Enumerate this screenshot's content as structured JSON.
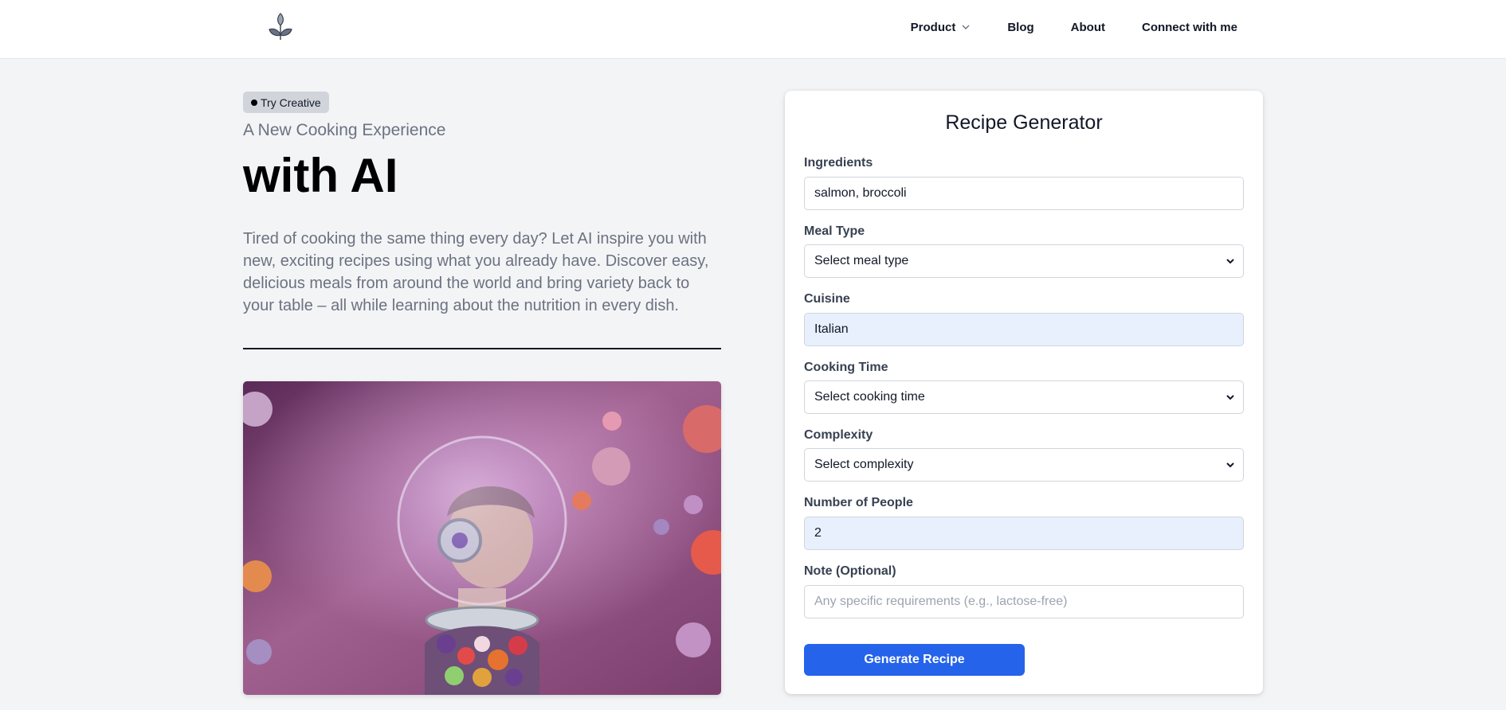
{
  "nav": {
    "logo_icon": "sprout-leaf-icon",
    "items": [
      {
        "label": "Product",
        "has_dropdown": true
      },
      {
        "label": "Blog"
      },
      {
        "label": "About"
      },
      {
        "label": "Connect with me"
      }
    ]
  },
  "hero": {
    "badge": "Try Creative",
    "subtitle": "A New Cooking Experience",
    "headline": "with AI",
    "description": "Tired of cooking the same thing every day? Let AI inspire you with new, exciting recipes using what you already have. Discover easy, delicious meals from around the world and bring variety back to your table – all while learning about the nutrition in every dish."
  },
  "form": {
    "title": "Recipe Generator",
    "ingredients": {
      "label": "Ingredients",
      "value": "salmon, broccoli"
    },
    "meal_type": {
      "label": "Meal Type",
      "value": "Select meal type"
    },
    "cuisine": {
      "label": "Cuisine",
      "value": "Italian"
    },
    "cooking_time": {
      "label": "Cooking Time",
      "value": "Select cooking time"
    },
    "complexity": {
      "label": "Complexity",
      "value": "Select complexity"
    },
    "people": {
      "label": "Number of People",
      "value": "2"
    },
    "note": {
      "label": "Note (Optional)",
      "value": "",
      "placeholder": "Any specific requirements (e.g., lactose-free)"
    },
    "submit_label": "Generate Recipe"
  },
  "colors": {
    "primary_button": "#2563eb",
    "autofill_background": "#e8f0fe",
    "page_background": "#f3f4f6"
  }
}
